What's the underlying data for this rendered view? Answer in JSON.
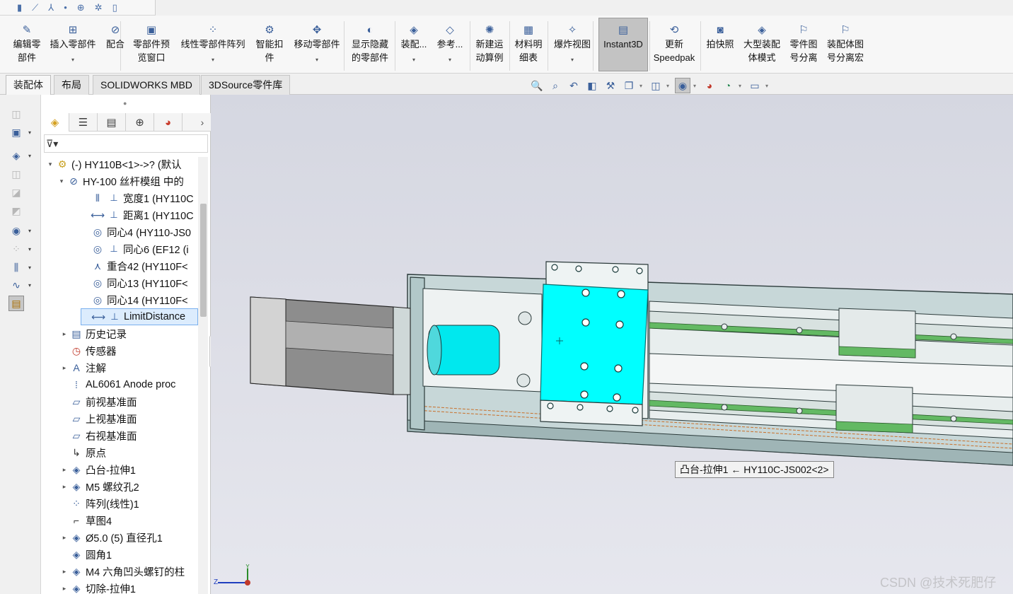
{
  "ribbon": {
    "buttons": [
      {
        "label1": "编辑零",
        "label2": "部件",
        "icon": "edit-component-icon"
      },
      {
        "label1": "插入零部件",
        "label2": "",
        "icon": "insert-components-icon",
        "dropdown": true
      },
      {
        "label1": "配合",
        "label2": "",
        "icon": "mate-icon"
      },
      {
        "label1": "零部件预",
        "label2": "览窗口",
        "icon": "component-preview-icon"
      },
      {
        "label1": "线性零部件阵列",
        "label2": "",
        "icon": "linear-pattern-icon",
        "dropdown": true
      },
      {
        "label1": "智能扣",
        "label2": "件",
        "icon": "smart-fasteners-icon"
      },
      {
        "label1": "移动零部件",
        "label2": "",
        "icon": "move-component-icon",
        "dropdown": true
      },
      {
        "label1": "显示隐藏",
        "label2": "的零部件",
        "icon": "show-hidden-icon"
      },
      {
        "label1": "装配...",
        "label2": "",
        "icon": "assembly-features-icon",
        "dropdown": true
      },
      {
        "label1": "参考...",
        "label2": "",
        "icon": "reference-geometry-icon",
        "dropdown": true
      },
      {
        "label1": "新建运",
        "label2": "动算例",
        "icon": "motion-study-icon"
      },
      {
        "label1": "材料明",
        "label2": "细表",
        "icon": "bom-icon"
      },
      {
        "label1": "爆炸视图",
        "label2": "",
        "icon": "exploded-view-icon",
        "dropdown": true
      },
      {
        "label1": "Instant3D",
        "label2": "",
        "icon": "instant3d-icon",
        "active": true
      },
      {
        "label1": "更新",
        "label2": "Speedpak",
        "icon": "speedpak-icon"
      },
      {
        "label1": "拍快照",
        "label2": "",
        "icon": "snapshot-icon"
      },
      {
        "label1": "大型装配",
        "label2": "体模式",
        "icon": "large-assembly-icon"
      },
      {
        "label1": "零件图",
        "label2": "号分离",
        "icon": "part-number-icon"
      },
      {
        "label1": "装配体图",
        "label2": "号分离宏",
        "icon": "assembly-number-macro-icon"
      }
    ]
  },
  "tabs": [
    "装配体",
    "布局",
    "SOLIDWORKS MBD",
    "3DSource零件库"
  ],
  "tree": {
    "root": "(-) HY110B<1>->? (默认",
    "sub": "HY-100 丝杆模组 中的",
    "mates": [
      {
        "label": "宽度1 (HY110C"
      },
      {
        "label": "距离1 (HY110C"
      },
      {
        "label": "同心4 (HY110-JS0"
      },
      {
        "label": "同心6 (EF12  (i"
      },
      {
        "label": "重合42 (HY110F<"
      },
      {
        "label": "同心13 (HY110F<"
      },
      {
        "label": "同心14 (HY110F<"
      },
      {
        "label": "LimitDistance"
      }
    ],
    "features": [
      {
        "label": "历史记录",
        "expandable": true
      },
      {
        "label": "传感器",
        "expandable": false
      },
      {
        "label": "注解",
        "expandable": true
      },
      {
        "label": "AL6061 Anode proc",
        "expandable": false
      },
      {
        "label": "前视基准面",
        "expandable": false
      },
      {
        "label": "上视基准面",
        "expandable": false
      },
      {
        "label": "右视基准面",
        "expandable": false
      },
      {
        "label": "原点",
        "expandable": false
      },
      {
        "label": "凸台-拉伸1",
        "expandable": true
      },
      {
        "label": "M5 螺纹孔2",
        "expandable": true
      },
      {
        "label": "阵列(线性)1",
        "expandable": false
      },
      {
        "label": "草图4",
        "expandable": false
      },
      {
        "label": "Ø5.0 (5) 直径孔1",
        "expandable": true
      },
      {
        "label": "圆角1",
        "expandable": false
      },
      {
        "label": "M4 六角凹头螺钉的柱",
        "expandable": true
      },
      {
        "label": "切除-拉伸1",
        "expandable": true
      }
    ]
  },
  "tooltip": "凸台-拉伸1 ← HY110C-JS002<2>",
  "watermark": "CSDN @技术死肥仔",
  "triad": {
    "x": "X",
    "y": "Y",
    "z": "Z"
  },
  "colors": {
    "selected_face": "#00ffff",
    "motor_cyan": "#00e8ee",
    "rail_green": "#63b963",
    "body_teal": "#b9cfd0"
  }
}
